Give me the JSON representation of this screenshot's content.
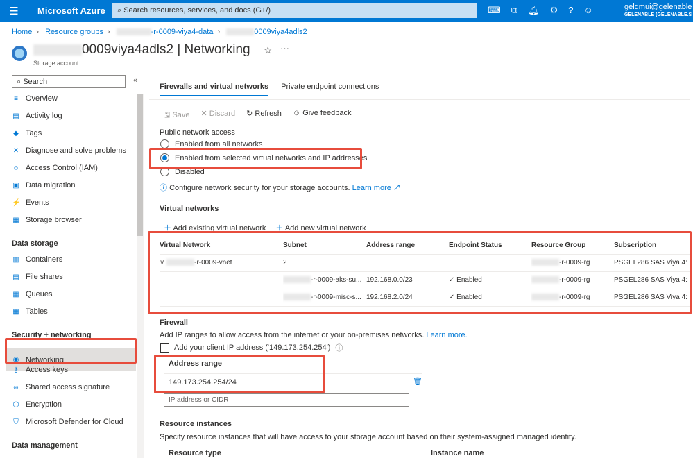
{
  "topbar": {
    "brand": "Microsoft Azure",
    "search_placeholder": "Search resources, services, and docs (G+/)",
    "user": "geldmui@gelenable",
    "tenant": "GELENABLE (GELENABLE.S"
  },
  "breadcrumb": [
    "Home",
    "Resource groups",
    "-r-0009-viya4-data",
    "0009viya4adls2"
  ],
  "title": "0009viya4adls2 | Networking",
  "subtitle": "Storage account",
  "sidebar": {
    "search": "Search",
    "items": [
      {
        "label": "Overview",
        "icon": "≡"
      },
      {
        "label": "Activity log",
        "icon": "▤"
      },
      {
        "label": "Tags",
        "icon": "◆"
      },
      {
        "label": "Diagnose and solve problems",
        "icon": "✕"
      },
      {
        "label": "Access Control (IAM)",
        "icon": "☺"
      },
      {
        "label": "Data migration",
        "icon": "▣"
      },
      {
        "label": "Events",
        "icon": "⚡"
      },
      {
        "label": "Storage browser",
        "icon": "▦"
      }
    ],
    "sections": [
      {
        "title": "Data storage",
        "items": [
          {
            "label": "Containers",
            "icon": "▥"
          },
          {
            "label": "File shares",
            "icon": "▤"
          },
          {
            "label": "Queues",
            "icon": "▦"
          },
          {
            "label": "Tables",
            "icon": "▦"
          }
        ]
      },
      {
        "title": "Security + networking",
        "items": [
          {
            "label": "Networking",
            "icon": "◉"
          },
          {
            "label": "Access keys",
            "icon": "⚷"
          },
          {
            "label": "Shared access signature",
            "icon": "∞"
          },
          {
            "label": "Encryption",
            "icon": "⬡"
          },
          {
            "label": "Microsoft Defender for Cloud",
            "icon": "⛉"
          }
        ]
      },
      {
        "title": "Data management",
        "items": []
      }
    ]
  },
  "tabs": [
    "Firewalls and virtual networks",
    "Private endpoint connections"
  ],
  "toolbar": {
    "save": "Save",
    "discard": "Discard",
    "refresh": "Refresh",
    "feedback": "Give feedback"
  },
  "access": {
    "label": "Public network access",
    "options": [
      "Enabled from all networks",
      "Enabled from selected virtual networks and IP addresses",
      "Disabled"
    ],
    "info": "Configure network security for your storage accounts.",
    "learn": "Learn more"
  },
  "vnets": {
    "title": "Virtual networks",
    "add_existing": "Add existing virtual network",
    "add_new": "Add new virtual network",
    "columns": [
      "Virtual Network",
      "Subnet",
      "Address range",
      "Endpoint Status",
      "Resource Group",
      "Subscription"
    ],
    "rows": [
      [
        "-r-0009-vnet",
        "2",
        "",
        "",
        "-r-0009-rg",
        "PSGEL286 SAS Viya 4: ..."
      ],
      [
        "",
        "-r-0009-aks-su...",
        "192.168.0.0/23",
        "✓ Enabled",
        "-r-0009-rg",
        "PSGEL286 SAS Viya 4: ..."
      ],
      [
        "",
        "-r-0009-misc-s...",
        "192.168.2.0/24",
        "✓ Enabled",
        "-r-0009-rg",
        "PSGEL286 SAS Viya 4: ..."
      ]
    ]
  },
  "firewall": {
    "title": "Firewall",
    "desc": "Add IP ranges to allow access from the internet or your on-premises networks.",
    "learn": "Learn more.",
    "client_ip": "Add your client IP address ('149.173.254.254')",
    "col": "Address range",
    "value": "149.173.254.254/24",
    "placeholder": "IP address or CIDR"
  },
  "instances": {
    "title": "Resource instances",
    "desc": "Specify resource instances that will have access to your storage account based on their system-assigned managed identity.",
    "columns": [
      "Resource type",
      "Instance name"
    ]
  }
}
